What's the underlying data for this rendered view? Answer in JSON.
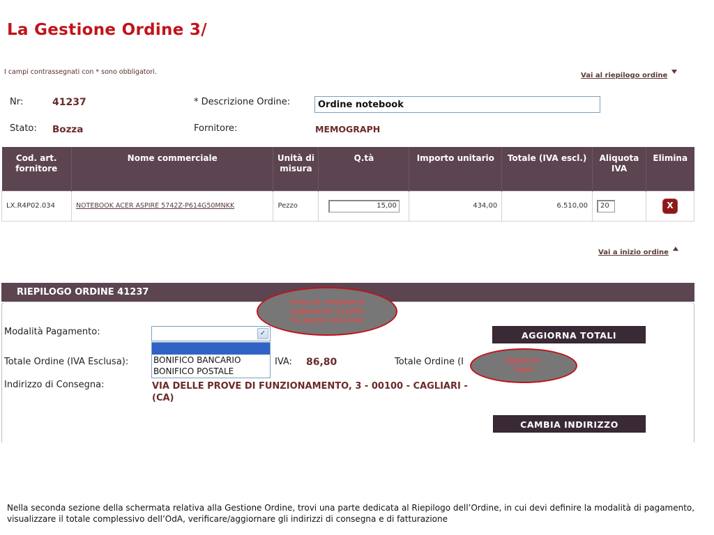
{
  "slide_title": "La Gestione Ordine 3/",
  "required_note": "I campi contrassegnati con * sono obbligatori.",
  "links": {
    "to_summary": "Vai al riepilogo ordine",
    "to_start": "Vai a inizio ordine"
  },
  "header": {
    "nr_label": "Nr:",
    "nr_value": "41237",
    "description_label": "* Descrizione Ordine:",
    "description_value": "Ordine notebook",
    "status_label": "Stato:",
    "status_value": "Bozza",
    "supplier_label": "Fornitore:",
    "supplier_value": "MEMOGRAPH"
  },
  "table": {
    "columns": [
      "Cod. art. fornitore",
      "Nome commerciale",
      "Unità di misura",
      "Q.tà",
      "Importo unitario",
      "Totale (IVA escl.)",
      "Aliquota IVA",
      "Elimina"
    ],
    "rows": [
      {
        "code": "LX.R4P02.034",
        "name": "NOTEBOOK ACER ASPIRE 5742Z-P614G50MNKK",
        "unit": "Pezzo",
        "qty": "15,00",
        "unit_price": "434,00",
        "total": "6.510,00",
        "vat": "20",
        "delete": "X"
      }
    ]
  },
  "summary": {
    "title": "RIEPILOGO ORDINE  41237",
    "payment_label": "Modalità Pagamento:",
    "payment_selected": "",
    "payment_options": [
      "",
      "BONIFICO BANCARIO",
      "BONIFICO POSTALE"
    ],
    "total_label": "Totale Ordine (IVA Esclusa):",
    "vat_label": "IVA:",
    "vat_value": "86,80",
    "total_incl_label": "Totale Ordine (I",
    "address_label": "Indirizzo di Consegna:",
    "address_value": "VIA DELLE PROVE DI FUNZIONAMENTO, 3 - 00100 - CAGLIARI - (CA)",
    "update_totals_button": "AGGIORNA   TOTALI",
    "change_address_button": "CAMBIA INDIRIZZO"
  },
  "callouts": {
    "payment": "Indica la modalità di pagamento a scelta tra quelle nella lista",
    "totals": "Aggiorna i totali"
  },
  "footer_text": "Nella seconda sezione della schermata relativa alla Gestione Ordine, trovi una parte dedicata al Riepilogo dell’Ordine, in cui devi definire la modalità di pagamento, visualizzare il totale complessivo dell’OdA, verificare/aggiornare gli indirizzi di consegna e di fatturazione",
  "colors": {
    "title_red": "#c0141b",
    "header_purple": "#5c4450",
    "button_dark": "#3a2a36",
    "value_brown": "#6b2a2a",
    "callout_gray": "#777777"
  }
}
